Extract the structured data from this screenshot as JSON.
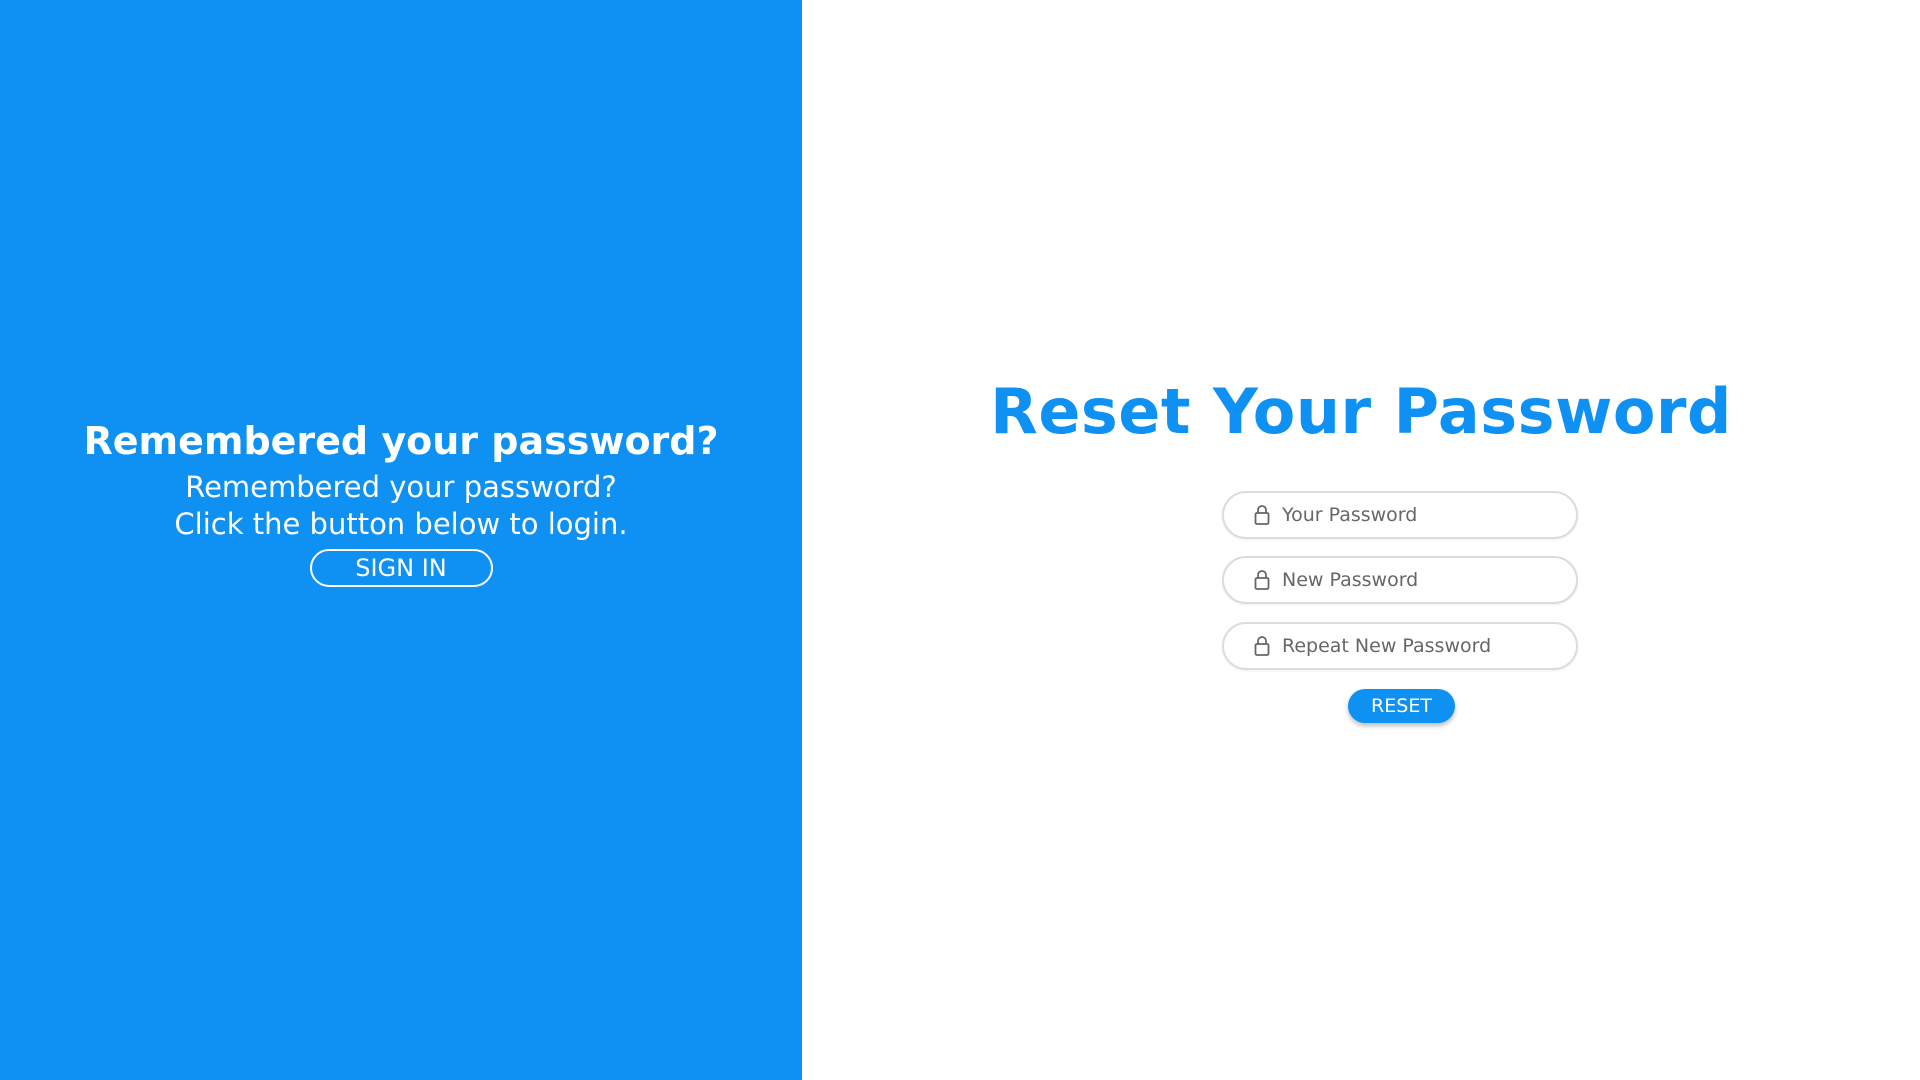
{
  "colors": {
    "accent": "#0e91f2",
    "panel_background": "#0e91f2",
    "page_background": "#ffffff",
    "field_border": "#dcdcdc"
  },
  "left_panel": {
    "title": "Remembered your password?",
    "text": "Remembered your password? Click the button below to login.",
    "signin_label": "SIGN IN"
  },
  "form": {
    "title": "Reset Your Password",
    "fields": [
      {
        "icon": "lock-icon",
        "placeholder": "Your Password",
        "value": ""
      },
      {
        "icon": "lock-icon",
        "placeholder": "New Password",
        "value": ""
      },
      {
        "icon": "lock-icon",
        "placeholder": "Repeat New Password",
        "value": ""
      }
    ],
    "reset_label": "RESET"
  }
}
